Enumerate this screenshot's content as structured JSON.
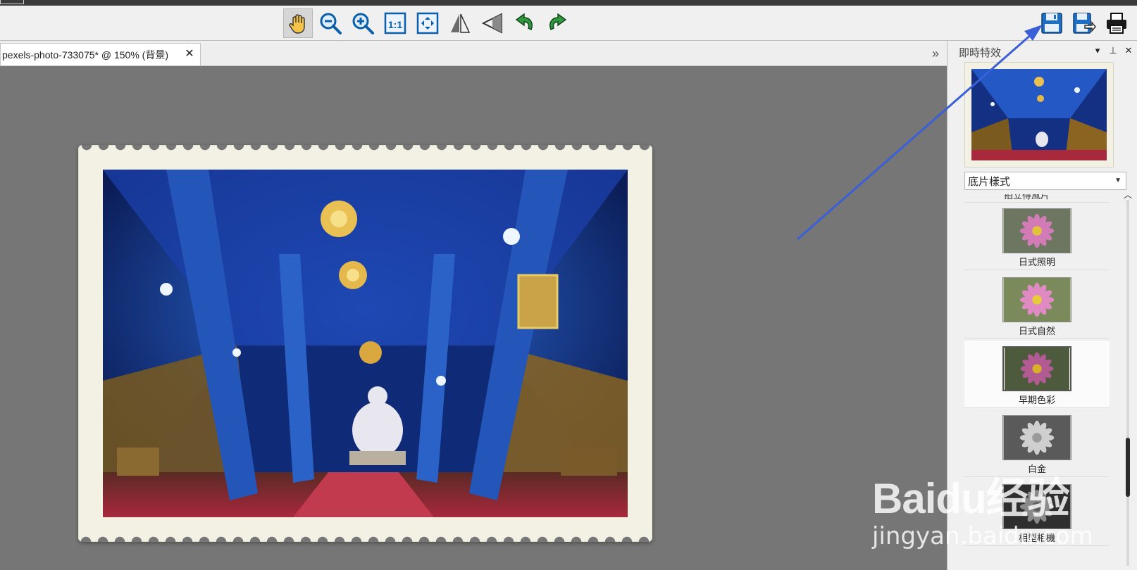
{
  "toolbar": {
    "tools": [
      {
        "name": "hand-tool-button",
        "icon": "hand-icon",
        "active": true
      },
      {
        "name": "zoom-out-button",
        "icon": "zoom-out-icon"
      },
      {
        "name": "zoom-in-button",
        "icon": "zoom-in-icon"
      },
      {
        "name": "actual-size-button",
        "icon": "actual-size-icon",
        "text": "1:1"
      },
      {
        "name": "fit-window-button",
        "icon": "fit-window-icon"
      },
      {
        "name": "flip-horizontal-button",
        "icon": "flip-horizontal-icon"
      },
      {
        "name": "perspective-button",
        "icon": "perspective-icon"
      },
      {
        "name": "rotate-left-button",
        "icon": "rotate-left-icon"
      },
      {
        "name": "rotate-right-button",
        "icon": "rotate-right-icon"
      }
    ],
    "right_tools": [
      {
        "name": "save-button",
        "icon": "save-icon"
      },
      {
        "name": "save-as-button",
        "icon": "save-as-icon"
      },
      {
        "name": "print-button",
        "icon": "printer-icon"
      }
    ]
  },
  "document": {
    "tab_title": "pexels-photo-733075* @ 150% (背景)",
    "close_glyph": "✕",
    "more_glyph": "»"
  },
  "panel": {
    "title": "即時特效",
    "controls": [
      "▾",
      "⊥",
      "✕"
    ],
    "preset_selected": "底片樣式",
    "partial_label": "拍立得風片",
    "effects": [
      {
        "label": "日式照明",
        "selected": false,
        "style": "light"
      },
      {
        "label": "日式自然",
        "selected": false,
        "style": "natural"
      },
      {
        "label": "早期色彩",
        "selected": true,
        "style": "early"
      },
      {
        "label": "白金",
        "selected": false,
        "style": "platinum"
      },
      {
        "label": "相型相機",
        "selected": false,
        "style": "mono"
      }
    ]
  },
  "watermark": {
    "brand": "Baidu经验",
    "url": "jingyan.baidu.com"
  },
  "colors": {
    "annotation_arrow": "#3a5fd6",
    "canvas_bg": "#767676",
    "toolbar_bg": "#f0f0f0"
  }
}
